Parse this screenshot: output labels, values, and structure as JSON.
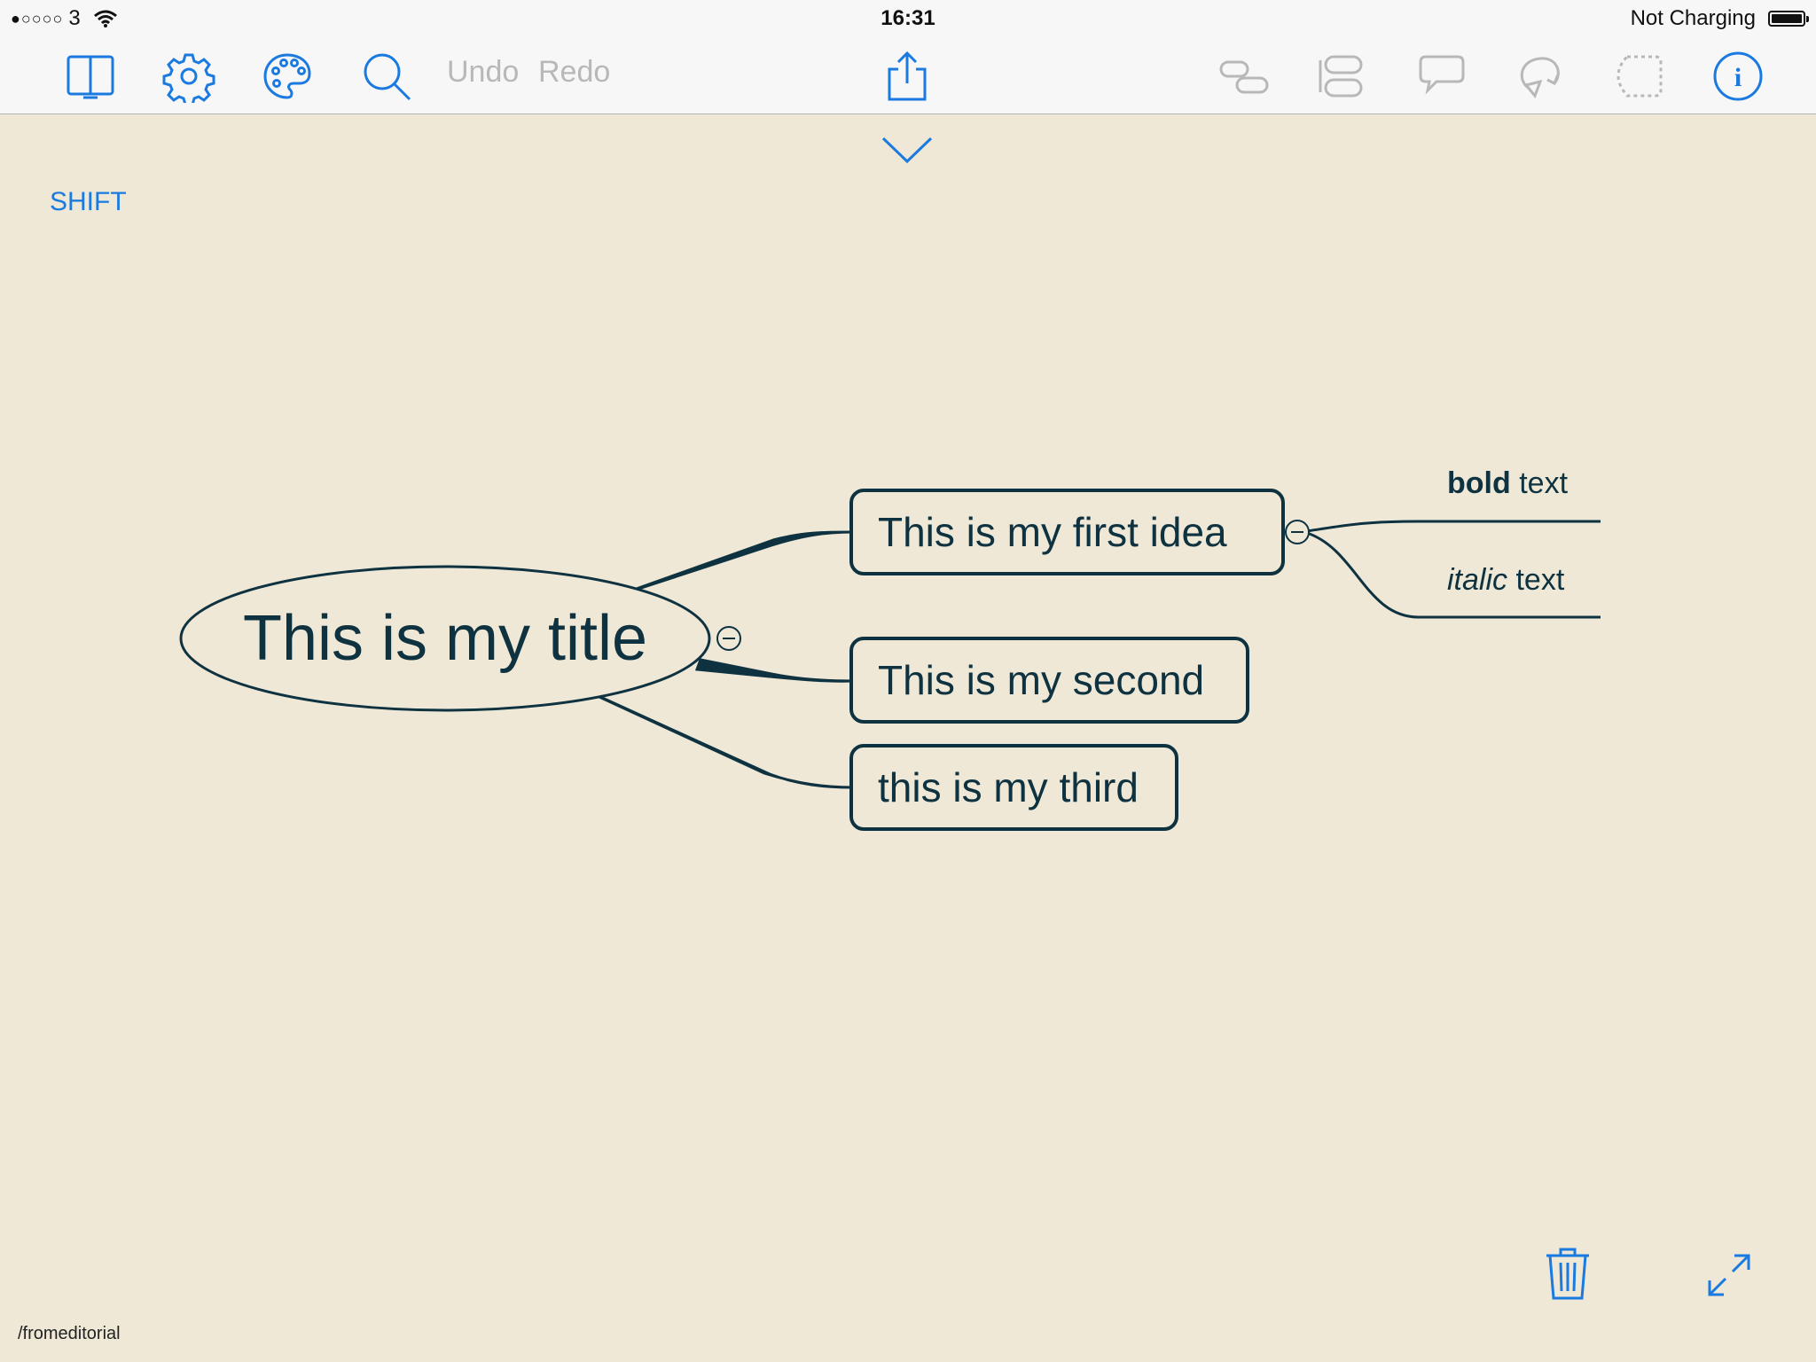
{
  "status": {
    "carrier": "3",
    "time": "16:31",
    "battery_text": "Not Charging"
  },
  "toolbar": {
    "undo": "Undo",
    "redo": "Redo",
    "accent_color": "#1a7ae0",
    "disabled_color": "#b8b8b8"
  },
  "canvas": {
    "shift_label": "SHIFT",
    "path": "/fromeditorial"
  },
  "mindmap": {
    "title": "This is my title",
    "children": [
      {
        "label": "This is my first idea"
      },
      {
        "label": "This is my second"
      },
      {
        "label": "this is my third"
      }
    ],
    "sub_children": [
      {
        "bold": "bold",
        "rest": " text"
      },
      {
        "italic": "italic",
        "rest": " text"
      }
    ],
    "line_color": "#0e3240",
    "background": "#efe8d7"
  }
}
